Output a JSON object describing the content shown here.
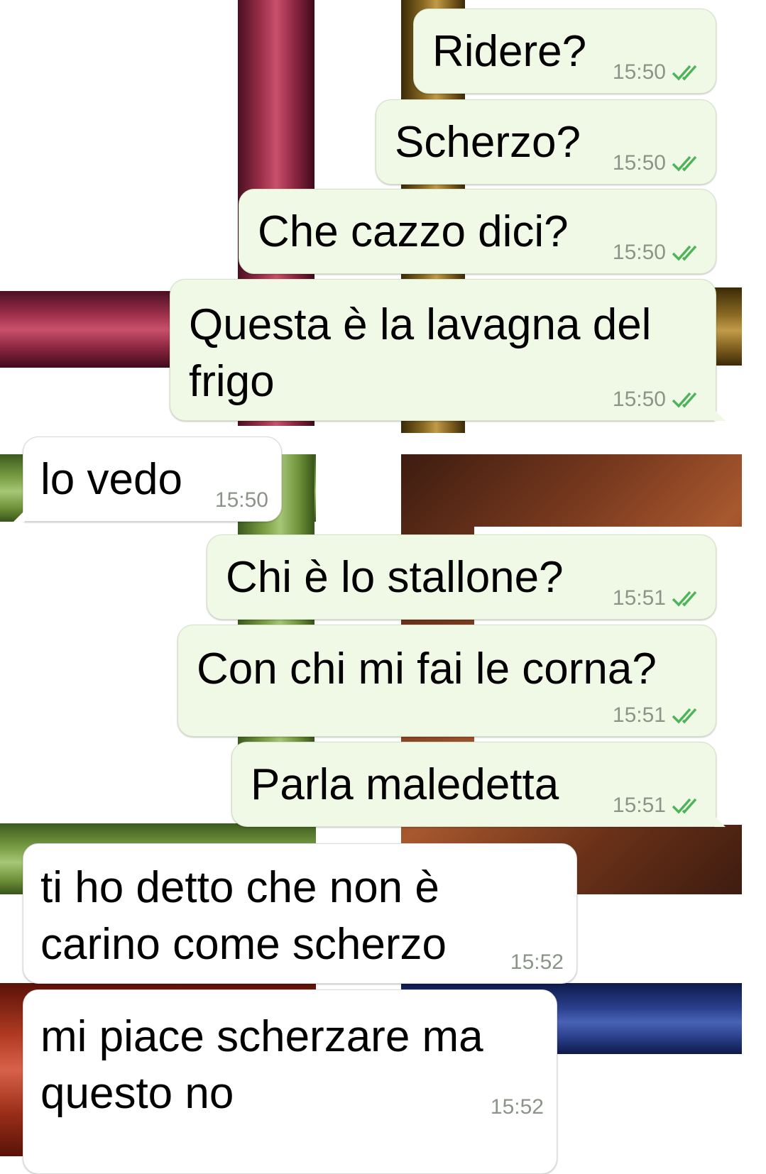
{
  "messages": [
    {
      "dir": "out",
      "text": "Ridere?",
      "time": "15:50",
      "ticks": "double-check-icon"
    },
    {
      "dir": "out",
      "text": "Scherzo?",
      "time": "15:50",
      "ticks": "double-check-icon"
    },
    {
      "dir": "out",
      "text": "Che cazzo dici?",
      "time": "15:50",
      "ticks": "double-check-icon"
    },
    {
      "dir": "out",
      "lines": [
        "Questa è la lavagna del",
        "frigo"
      ],
      "time": "15:50",
      "ticks": "double-check-icon"
    },
    {
      "dir": "in",
      "text": "lo vedo",
      "time": "15:50"
    },
    {
      "dir": "out",
      "text": "Chi è lo stallone?",
      "time": "15:51",
      "ticks": "double-check-icon"
    },
    {
      "dir": "out",
      "text": "Con chi mi fai le corna?",
      "time": "15:51",
      "ticks": "double-check-icon"
    },
    {
      "dir": "out",
      "text": "Parla maledetta",
      "time": "15:51",
      "ticks": "double-check-icon"
    },
    {
      "dir": "in",
      "lines": [
        "ti ho detto che non è",
        "carino come scherzo"
      ],
      "time": "15:52"
    },
    {
      "dir": "in",
      "lines": [
        "mi piace scherzare ma",
        "questo no"
      ],
      "time": "15:52"
    }
  ],
  "colors": {
    "outgoing_bubble": "#f0f9e6",
    "incoming_bubble": "#ffffff",
    "tick": "#4fb35a",
    "time": "#8c948a"
  }
}
